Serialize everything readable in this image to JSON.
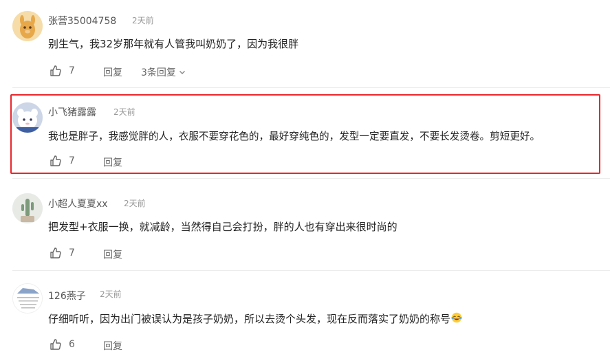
{
  "comments": [
    {
      "username": "张营35004758",
      "time": "2天前",
      "text": "别生气，我32岁那年就有人管我叫奶奶了，因为我很胖",
      "likes": "7",
      "reply_label": "回复",
      "replies_label": "3条回复"
    },
    {
      "username": "小飞猪露露",
      "time": "2天前",
      "text": "我也是胖子，我感觉胖的人，衣服不要穿花色的，最好穿纯色的，发型一定要直发，不要长发烫卷。剪短更好。",
      "likes": "7",
      "reply_label": "回复",
      "highlighted": true
    },
    {
      "username": "小超人夏夏xx",
      "time": "2天前",
      "text": "把发型+衣服一换，就减龄，当然得自己会打扮，胖的人也有穿出来很时尚的",
      "likes": "7",
      "reply_label": "回复"
    },
    {
      "username": "126燕子",
      "time": "2天前",
      "text": "仔细听听，因为出门被误认为是孩子奶奶，所以去烫个头发，现在反而落实了奶奶的称号",
      "likes": "6",
      "reply_label": "回复",
      "emoji": "face-with-tears-emoji"
    }
  ],
  "colors": {
    "highlight_border": "#e8262c",
    "username": "#555555",
    "time": "#999999",
    "text": "#222222",
    "action": "#666666"
  },
  "icons": [
    "thumbs-up-icon",
    "chevron-down-icon"
  ]
}
